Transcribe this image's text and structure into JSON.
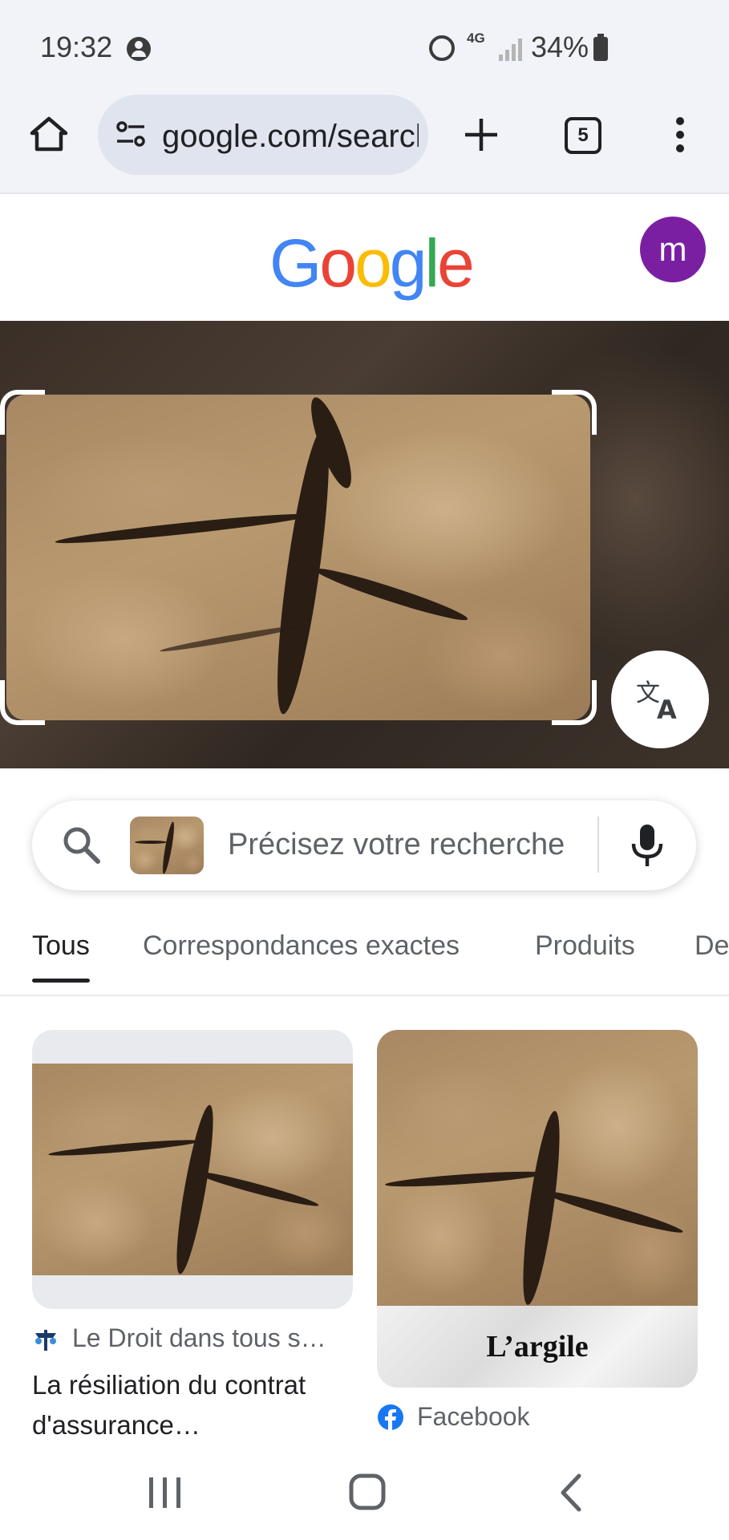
{
  "status_bar": {
    "time": "19:32",
    "network": "4G",
    "battery": "34%"
  },
  "browser": {
    "url": "google.com/search",
    "tab_count": "5"
  },
  "google": {
    "logo": "Google",
    "avatar_letter": "m",
    "logo_colors": [
      "#4285F4",
      "#EA4335",
      "#FBBC05",
      "#4285F4",
      "#34A853",
      "#EA4335"
    ]
  },
  "search": {
    "placeholder": "Précisez votre recherche"
  },
  "tabs": [
    {
      "label": "Tous",
      "active": true
    },
    {
      "label": "Correspondances exactes"
    },
    {
      "label": "Produits"
    },
    {
      "label": "De"
    }
  ],
  "results": [
    {
      "source": "Le Droit dans tous s…",
      "title": "La résiliation du contrat d'assurance…"
    },
    {
      "source": "Facebook",
      "overlay_text": "L’argile"
    }
  ],
  "colors": {
    "avatar": "#7b1fa2",
    "facebook": "#1877F2"
  }
}
